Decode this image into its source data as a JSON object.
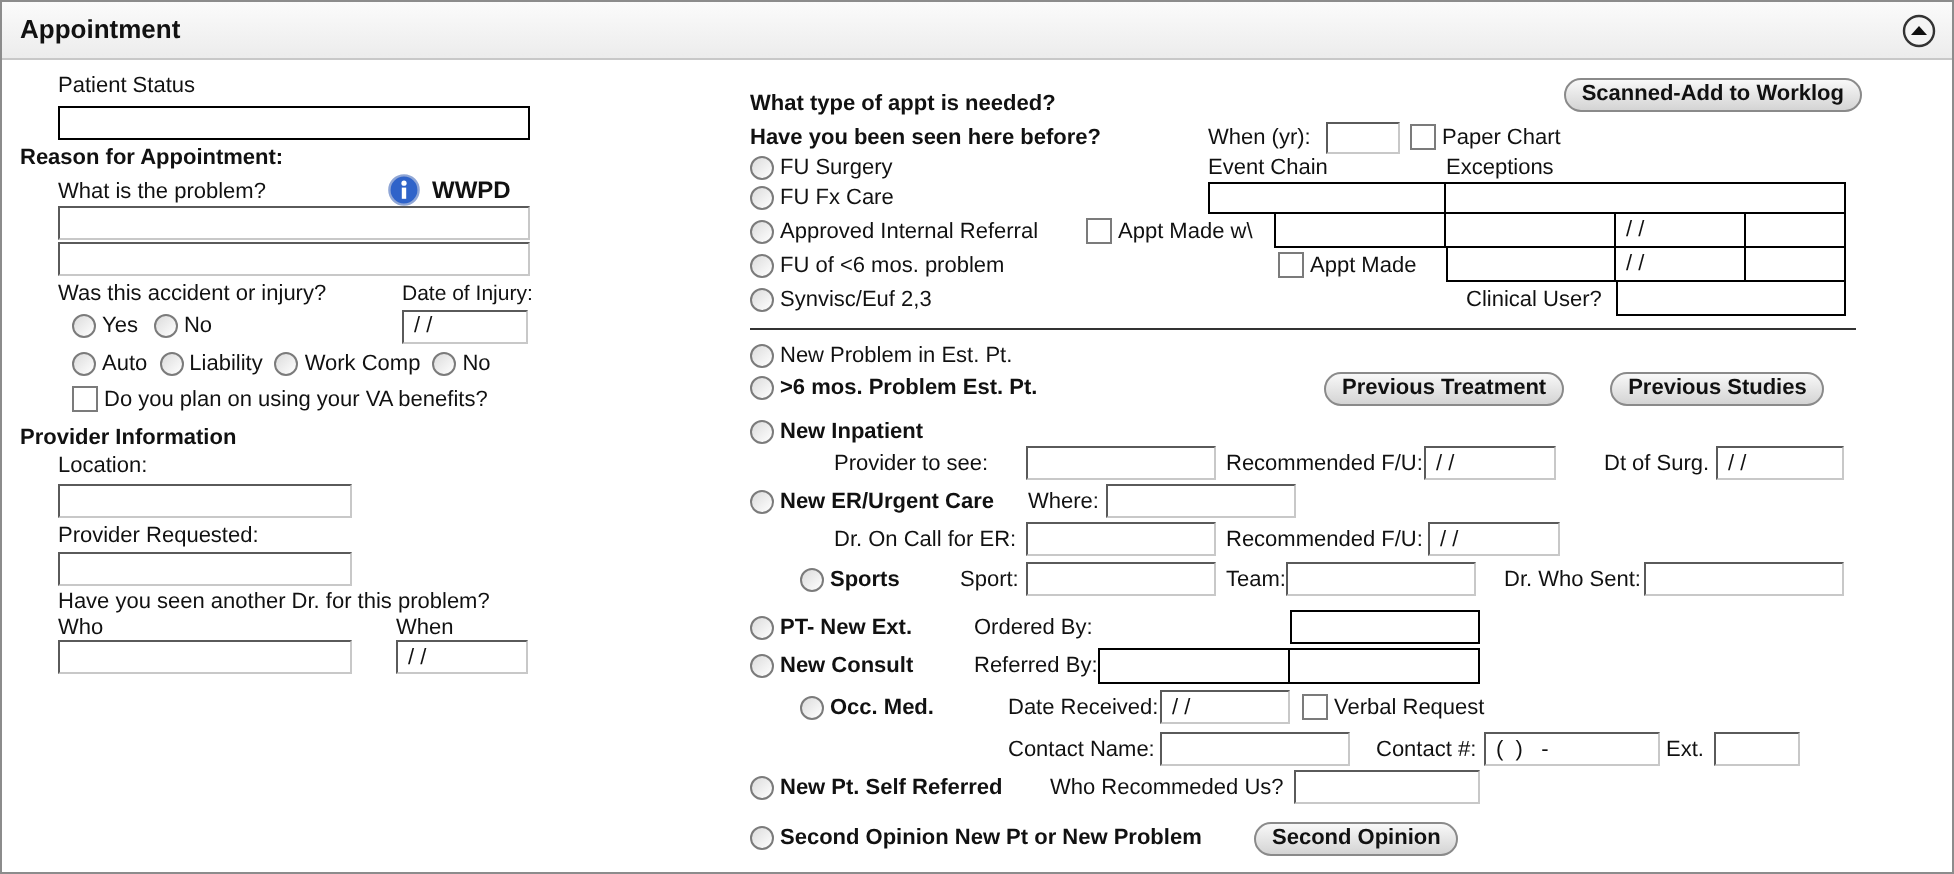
{
  "panel": {
    "title": "Appointment"
  },
  "left": {
    "patient_status_label": "Patient Status",
    "reason_heading": "Reason for Appointment:",
    "problem_label": "What is the problem?",
    "wwpd": "WWPD",
    "injury_label": "Was this accident or injury?",
    "injury_date_label": "Date of Injury:",
    "injury_date_value": "/ /",
    "yes_no": [
      {
        "label": "Yes",
        "selected": false
      },
      {
        "label": "No",
        "selected": false
      }
    ],
    "injury_types": [
      {
        "label": "Auto",
        "selected": false
      },
      {
        "label": "Liability",
        "selected": false
      },
      {
        "label": "Work Comp",
        "selected": false
      },
      {
        "label": "No",
        "selected": false
      }
    ],
    "va": {
      "label": "Do you plan on using your VA benefits?",
      "checked": false
    },
    "provider_heading": "Provider Information",
    "location_label": "Location:",
    "requested_label": "Provider Requested:",
    "seen_label": "Have you seen another Dr. for this problem?",
    "who_label": "Who",
    "when_label": "When",
    "when_value": "/ /"
  },
  "right": {
    "appt_type_heading": "What type of appt is needed?",
    "scanned_button": "Scanned-Add to Worklog",
    "seen_heading": "Have you been seen here before?",
    "when_label": "When (yr):",
    "paper_chart": {
      "label": "Paper Chart",
      "checked": false
    },
    "event_chain_label": "Event Chain",
    "exceptions_label": "Exceptions",
    "followup_types": [
      {
        "label": "FU Surgery",
        "selected": false
      },
      {
        "label": "FU Fx Care",
        "selected": false
      },
      {
        "label": "Approved Internal Referral",
        "selected": false
      },
      {
        "label": "FU of <6 mos. problem",
        "selected": false
      },
      {
        "label": "Synvisc/Euf 2,3",
        "selected": false
      }
    ],
    "appt_made_with": {
      "label": "Appt Made w\\",
      "checked": false
    },
    "appt_made": {
      "label": "Appt Made",
      "checked": false
    },
    "date_values": [
      "/ /",
      "/ /"
    ],
    "clinical_user_label": "Clinical User?",
    "new_problem": {
      "label": "New Problem in Est. Pt.",
      "selected": false
    },
    "over_six": {
      "label": ">6 mos. Problem Est. Pt.",
      "selected": false
    },
    "previous_treatment": "Previous Treatment",
    "previous_studies": "Previous Studies",
    "inpatient": {
      "label": "New Inpatient",
      "selected": false,
      "provider_label": "Provider to see:",
      "followup_label": "Recommended F/U:",
      "followup_value": "/ /",
      "surgery_label": "Dt of Surg.",
      "surgery_value": "/ /"
    },
    "er": {
      "label": "New ER/Urgent Care",
      "selected": false,
      "where_label": "Where:",
      "on_call_label": "Dr. On Call for ER:",
      "followup_label": "Recommended F/U:",
      "followup_value": "/ /"
    },
    "sports": {
      "label": "Sports",
      "selected": false,
      "sport_label": "Sport:",
      "team_label": "Team:",
      "sent_label": "Dr. Who Sent:"
    },
    "pt_new_ext": {
      "label": "PT- New Ext.",
      "selected": false,
      "ordered_label": "Ordered By:"
    },
    "consult": {
      "label": "New Consult",
      "selected": false,
      "referred_label": "Referred By:"
    },
    "occ_med": {
      "label": "Occ. Med.",
      "selected": false,
      "received_label": "Date Received:",
      "received_value": "/ /",
      "verbal": {
        "label": "Verbal Request",
        "checked": false
      },
      "contact_name_label": "Contact Name:",
      "contact_label": "Contact #:",
      "contact_value": "(  )   -",
      "ext_label": "Ext."
    },
    "self_referred": {
      "label": "New Pt. Self Referred",
      "selected": false,
      "who_label": "Who Recommeded Us?"
    },
    "second_opinion": {
      "label": "Second Opinion New Pt or New Problem",
      "selected": false,
      "button": "Second Opinion"
    }
  }
}
